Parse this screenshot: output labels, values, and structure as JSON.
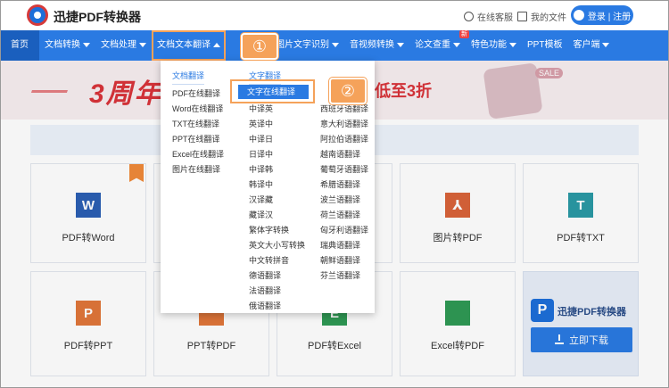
{
  "brand": "迅捷PDF转换器",
  "top_links": {
    "service": "在线客服",
    "my_files": "我的文件",
    "login": "登录 | 注册"
  },
  "nav": {
    "home": "首页",
    "items": [
      "文档转换",
      "文档处理",
      "文档文本翻译",
      "图片文字识别",
      "音视频转换",
      "论文查重",
      "特色功能",
      "PPT模板",
      "客户端"
    ],
    "new_badge": "新"
  },
  "banner": {
    "headline": "3周年",
    "offer": "低至3折",
    "sale": "SALE"
  },
  "dropdown": {
    "col1_title": "文档翻译",
    "col1_items": [
      "PDF在线翻译",
      "Word在线翻译",
      "TXT在线翻译",
      "PPT在线翻译",
      "Excel在线翻译",
      "图片在线翻译"
    ],
    "col2_title": "文字翻译",
    "col2_selected": "文字在线翻译",
    "col2_items": [
      "中译英",
      "英译中",
      "中译日",
      "日译中",
      "中译韩",
      "韩译中",
      "汉译藏",
      "藏译汉",
      "繁体字转换",
      "英文大小写转换",
      "中文转拼音",
      "德语翻译",
      "法语翻译",
      "俄语翻译"
    ],
    "col3_items": [
      "西班牙语翻译",
      "意大利语翻译",
      "阿拉伯语翻译",
      "越南语翻译",
      "葡萄牙语翻译",
      "希腊语翻译",
      "波兰语翻译",
      "荷兰语翻译",
      "匈牙利语翻译",
      "瑞典语翻译",
      "朝鲜语翻译",
      "芬兰语翻译"
    ]
  },
  "tools": {
    "row1": [
      "PDF转Word",
      "",
      "",
      "图片转PDF",
      "PDF转TXT"
    ],
    "row2": [
      "PDF转PPT",
      "PPT转PDF",
      "PDF转Excel",
      "Excel转PDF"
    ],
    "icon_letters": [
      "W",
      "P",
      "E",
      "T"
    ]
  },
  "promo": {
    "name": "迅捷PDF转换器",
    "download": "立即下载"
  },
  "steps": {
    "one": "①",
    "two": "②"
  },
  "colors": {
    "primary": "#2a7ae2",
    "highlight": "#f5a25a",
    "banner_red": "#d9343a"
  }
}
